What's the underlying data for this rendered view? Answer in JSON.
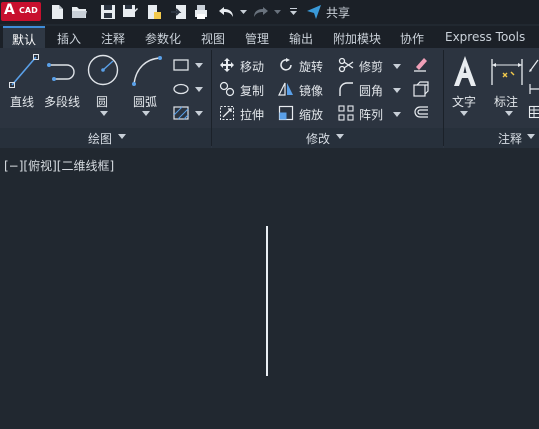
{
  "quick_access": {
    "logo": {
      "letter": "A",
      "text": "CAD"
    },
    "share_label": "共享",
    "icons": [
      "new-file-icon",
      "open-folder-icon",
      "save-icon",
      "save-as-icon",
      "publish-icon",
      "import-icon",
      "export-icon",
      "print-icon",
      "undo-icon",
      "redo-icon",
      "customize-dropdown-icon",
      "share-icon"
    ]
  },
  "tabs": [
    "默认",
    "插入",
    "注释",
    "参数化",
    "视图",
    "管理",
    "输出",
    "附加模块",
    "协作",
    "Express Tools"
  ],
  "ribbon": {
    "draw": {
      "title": "绘图",
      "line": "直线",
      "polyline": "多段线",
      "circle": "圆",
      "arc": "圆弧"
    },
    "modify": {
      "title": "修改",
      "move": "移动",
      "rotate": "旋转",
      "trim": "修剪",
      "copy": "复制",
      "mirror": "镜像",
      "fillet": "圆角",
      "stretch": "拉伸",
      "scale": "缩放",
      "array": "阵列"
    },
    "annotation": {
      "title": "注释",
      "text": "文字",
      "dimension": "标注"
    }
  },
  "viewport": {
    "label": "[−][俯视][二维线框]"
  },
  "colors": {
    "background": "#212830",
    "ribbon": "#2c3440",
    "active_tab_accent": "#3f8cd9",
    "logo": "#c8102e"
  }
}
